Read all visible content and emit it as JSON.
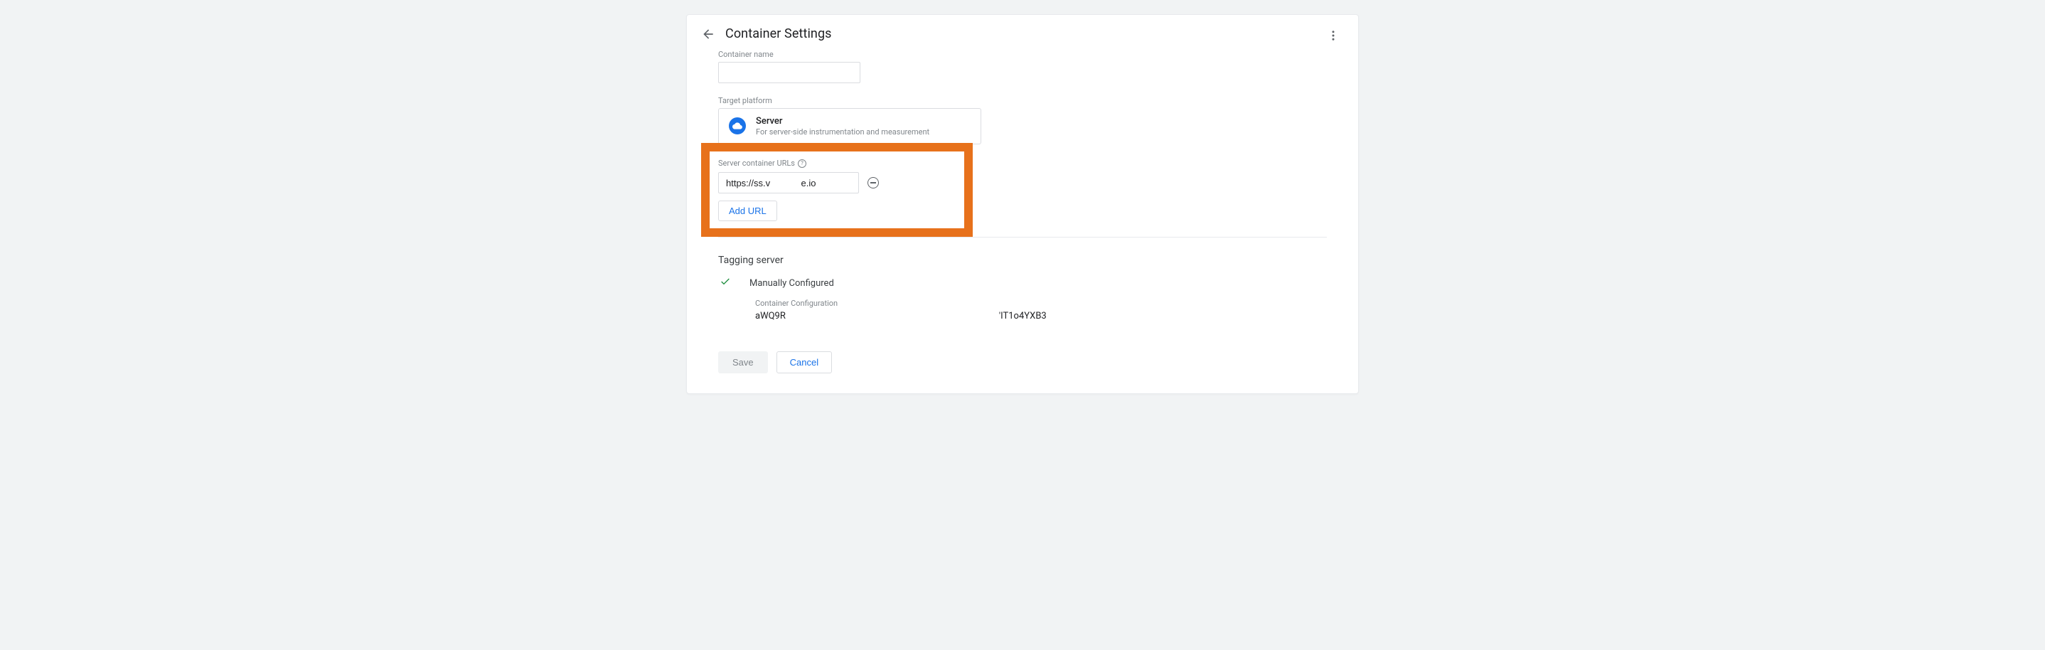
{
  "header": {
    "title": "Container Settings"
  },
  "form": {
    "container_name_label": "Container name",
    "container_name_value": "",
    "target_platform_label": "Target platform",
    "platform": {
      "title": "Server",
      "description": "For server-side instrumentation and measurement"
    },
    "server_urls_label": "Server container URLs",
    "url_value": "https://ss.v            e.io",
    "add_url_label": "Add URL"
  },
  "tagging": {
    "heading": "Tagging server",
    "status": "Manually Configured",
    "config_label": "Container Configuration",
    "value1": "aWQ9R",
    "value2": "'IT1o4YXB3"
  },
  "actions": {
    "save": "Save",
    "cancel": "Cancel"
  }
}
